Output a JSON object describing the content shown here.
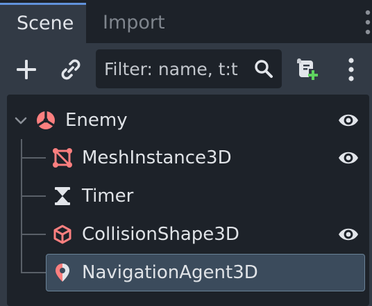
{
  "tabs": [
    {
      "label": "Scene",
      "active": true
    },
    {
      "label": "Import",
      "active": false
    }
  ],
  "toolbar": {
    "add_icon": "plus-icon",
    "link_icon": "link-icon",
    "filter_placeholder": "Filter: name, t:t",
    "search_icon": "search-icon",
    "script_icon": "attach-script-icon",
    "menu_icon": "vertical-dots-icon"
  },
  "tree": {
    "root": {
      "label": "Enemy",
      "icon": "node3d-icon",
      "expanded": true,
      "visible_toggle": true
    },
    "children": [
      {
        "label": "MeshInstance3D",
        "icon": "mesh-instance-icon",
        "visible_toggle": true,
        "selected": false
      },
      {
        "label": "Timer",
        "icon": "hourglass-icon",
        "visible_toggle": false,
        "selected": false
      },
      {
        "label": "CollisionShape3D",
        "icon": "cube-icon",
        "visible_toggle": true,
        "selected": false
      },
      {
        "label": "NavigationAgent3D",
        "icon": "location-pin-icon",
        "visible_toggle": false,
        "selected": true
      }
    ]
  },
  "colors": {
    "accent": "#6192db",
    "node3d": "#fc7f7f",
    "panel": "#323a45",
    "background": "#1d2229"
  }
}
